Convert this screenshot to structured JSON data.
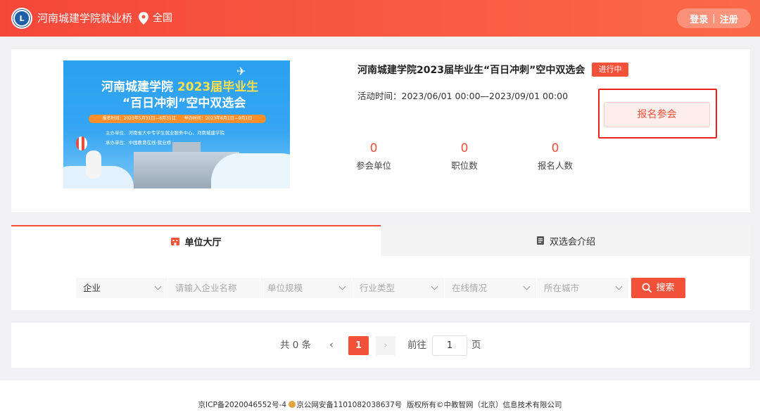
{
  "header": {
    "site_title": "河南城建学院就业桥",
    "location": "全国",
    "login_label": "登录",
    "separator": "|",
    "register_label": "注册",
    "accent_color": "#f4513a"
  },
  "event": {
    "name": "河南城建学院2023届毕业生“百日冲刺”空中双选会",
    "status": "进行中",
    "time": "活动时间：2023/06/01 00:00—2023/09/01 00:00",
    "register_button": "报名参会",
    "stats": [
      {
        "value": "0",
        "label": "参会单位"
      },
      {
        "value": "0",
        "label": "职位数"
      },
      {
        "value": "0",
        "label": "报名人数"
      }
    ],
    "banner": {
      "title_school": "河南城建学院",
      "title_year": "2023届毕业生",
      "title_line2": "“百日冲刺”空中双选会",
      "dates": "报名时间：2023年5月31日—6月31日　　举办时间：2023年6月1日—9月1日",
      "host": "主办单位：河南省大中专学生就业服务中心、河南城建学院",
      "organizer": "承办单位：中国教育在线·就业桥"
    }
  },
  "tabs": [
    {
      "label": "单位大厅",
      "icon": "building-icon",
      "active": true
    },
    {
      "label": "双选会介绍",
      "icon": "document-icon",
      "active": false
    }
  ],
  "filters": {
    "type_value": "企业",
    "company_placeholder": "请输入企业名称",
    "scale_placeholder": "单位规模",
    "industry_placeholder": "行业类型",
    "online_placeholder": "在线情况",
    "city_placeholder": "所在城市",
    "search_label": "搜索"
  },
  "pagination": {
    "total": "共 0 条",
    "prev": "‹",
    "current_page": "1",
    "next": "›",
    "goto_label": "前往",
    "goto_value": "1",
    "page_suffix": "页"
  },
  "footer": {
    "icp": "京ICP备2020046552号-4",
    "police": "京公网安备11010820386​37号",
    "copyright": "版权所有©中教智网（北京）信息技术有限公司"
  }
}
